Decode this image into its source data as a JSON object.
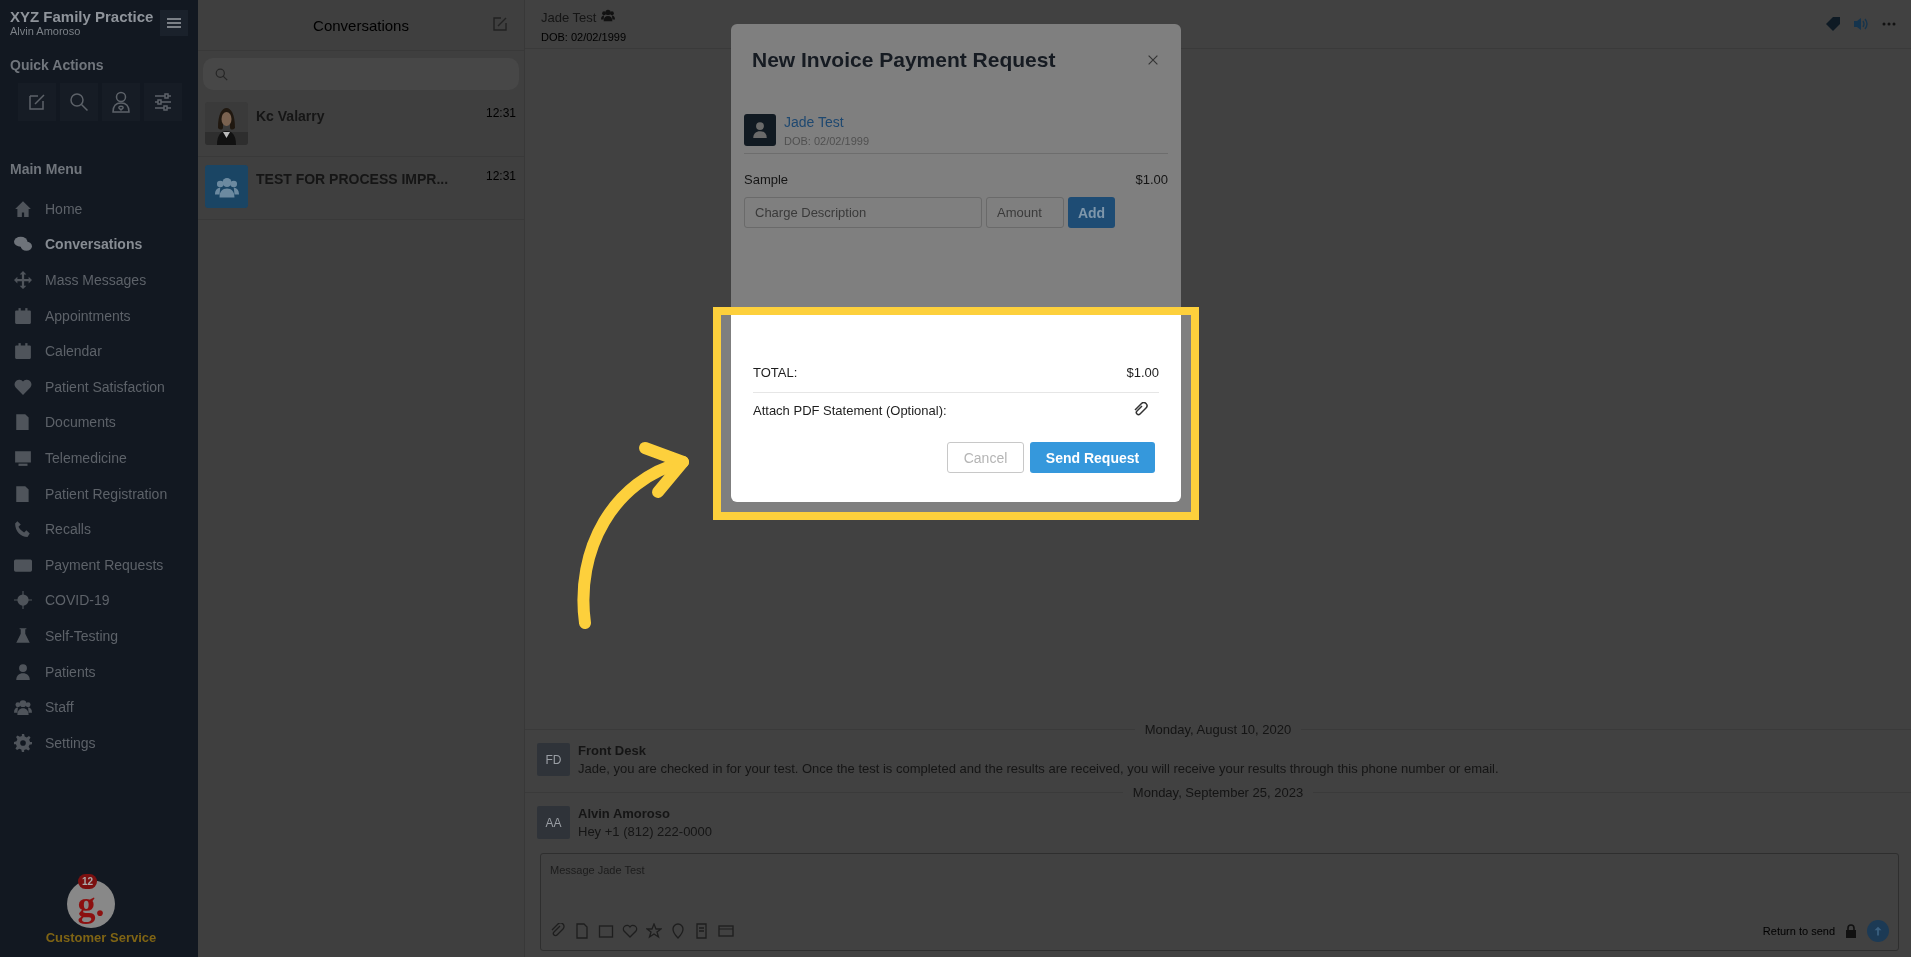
{
  "sidebar": {
    "practice": "XYZ Family Practice",
    "user": "Alvin Amoroso",
    "quick_actions_title": "Quick Actions",
    "main_menu_title": "Main Menu",
    "menu": [
      {
        "label": "Home",
        "selected": false
      },
      {
        "label": "Conversations",
        "selected": true
      },
      {
        "label": "Mass Messages",
        "selected": false
      },
      {
        "label": "Appointments",
        "selected": false
      },
      {
        "label": "Calendar",
        "selected": false
      },
      {
        "label": "Patient Satisfaction",
        "selected": false
      },
      {
        "label": "Documents",
        "selected": false
      },
      {
        "label": "Telemedicine",
        "selected": false
      },
      {
        "label": "Patient Registration",
        "selected": false
      },
      {
        "label": "Recalls",
        "selected": false
      },
      {
        "label": "Payment Requests",
        "selected": false
      },
      {
        "label": "COVID-19",
        "selected": false
      },
      {
        "label": "Self-Testing",
        "selected": false
      },
      {
        "label": "Patients",
        "selected": false
      },
      {
        "label": "Staff",
        "selected": false
      },
      {
        "label": "Settings",
        "selected": false
      }
    ],
    "support": {
      "logo": "g.",
      "badge": "12",
      "label": "Customer Service"
    }
  },
  "conversations": {
    "title": "Conversations",
    "items": [
      {
        "kind": "picture",
        "name": "Kc Valarry",
        "time": "12:31"
      },
      {
        "kind": "group",
        "name": "TEST FOR PROCESS IMPR...",
        "time": "12:31"
      }
    ]
  },
  "chat": {
    "name": "Jade Test",
    "dob": "DOB: 02/02/1999",
    "messages": [
      {
        "date": "Monday, August 10, 2020",
        "initials": "FD",
        "sender": "Front Desk",
        "text": "Jade, you are checked in for your test. Once the test is completed and the results are received, you will receive your results through this phone number or email."
      },
      {
        "date": "Monday, September 25, 2023",
        "initials": "AA",
        "sender": "Alvin Amoroso",
        "text": "Hey +1 (812) 222-0000"
      }
    ],
    "composer": {
      "placeholder": "Message Jade Test",
      "hint": "Return to send"
    }
  },
  "modal": {
    "title": "New Invoice Payment Request",
    "patient": "Jade Test",
    "dob": "DOB: 02/02/1999",
    "charges": [
      {
        "description": "Sample",
        "amount": "$1.00"
      }
    ],
    "description_placeholder": "Charge Description",
    "amount_placeholder": "Amount",
    "add": "Add",
    "total_label": "TOTAL:",
    "total": "$1.00",
    "attach": "Attach PDF Statement (Optional):",
    "cancel": "Cancel",
    "send": "Send Request"
  }
}
